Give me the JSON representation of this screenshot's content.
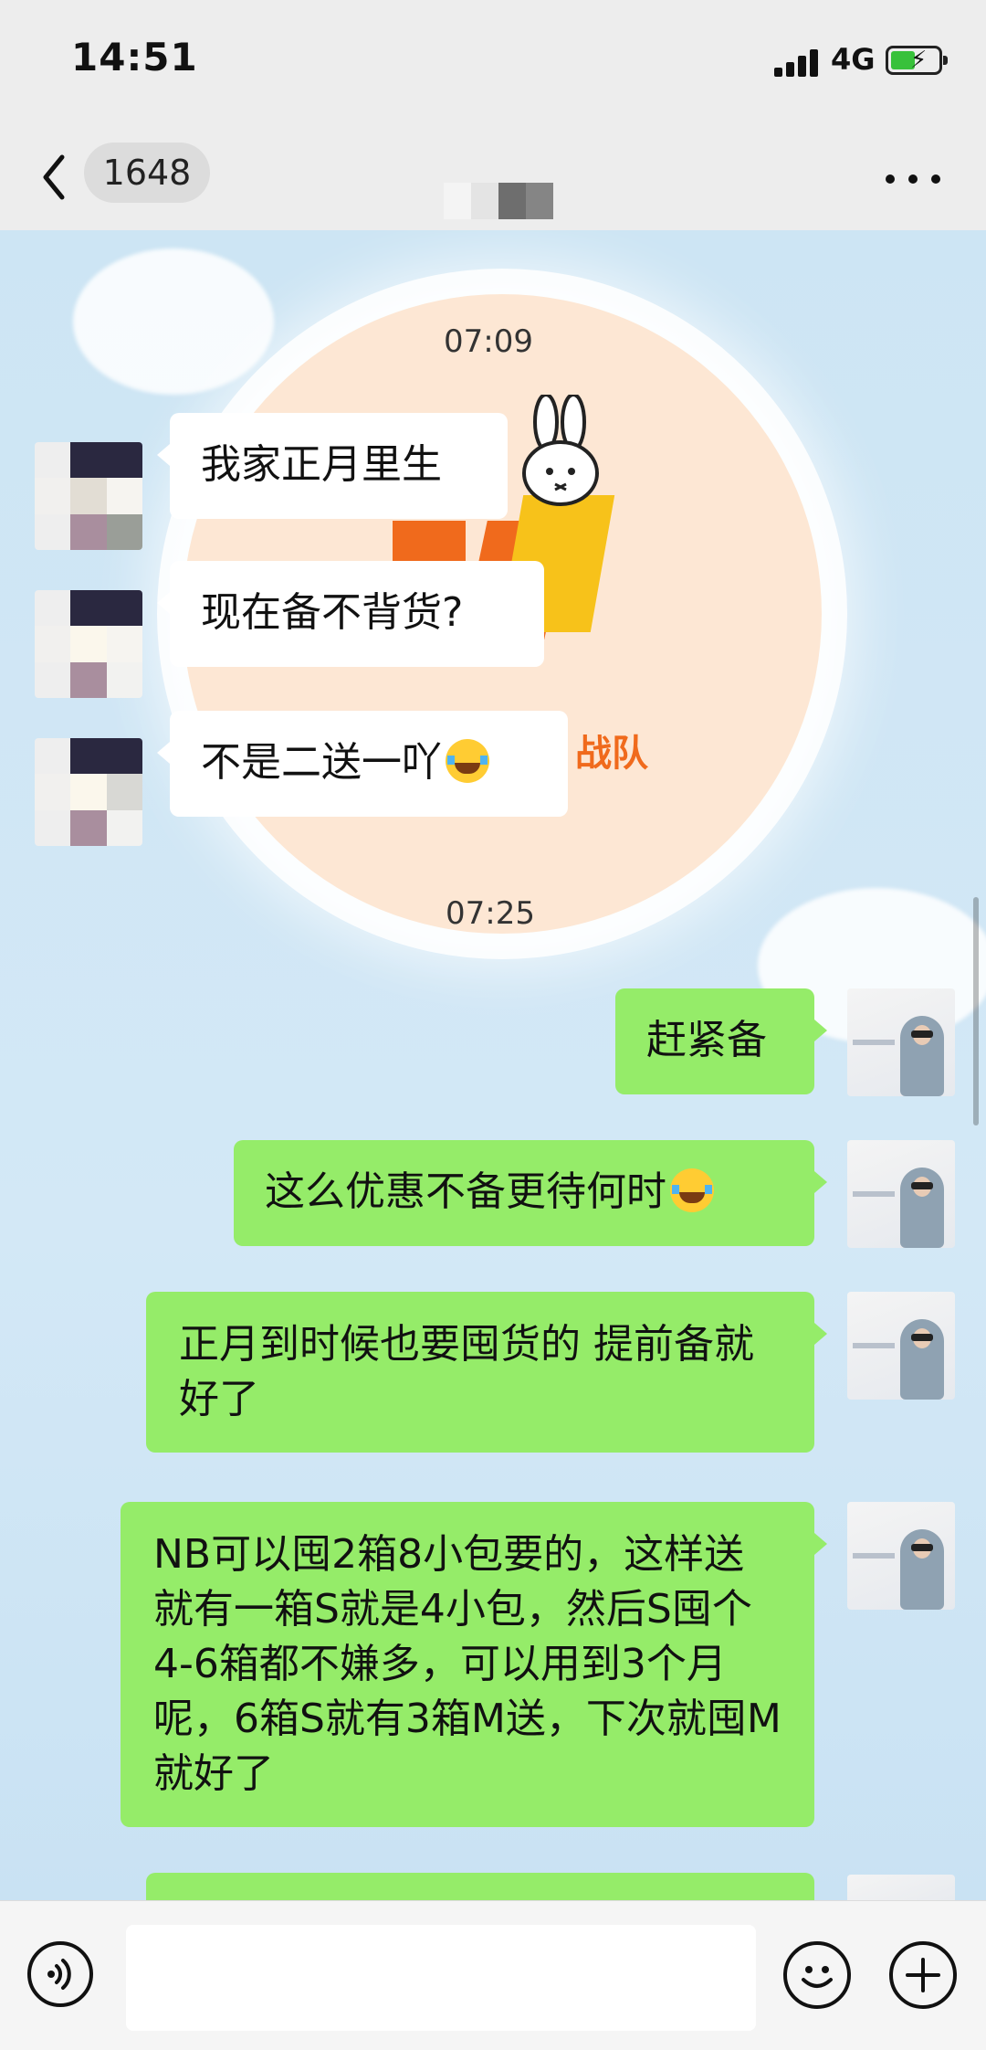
{
  "status_bar": {
    "time": "14:51",
    "network": "4G",
    "battery_charging": true
  },
  "nav": {
    "unread_count": "1648",
    "back_icon": "chevron-left-icon",
    "more_icon": "ellipsis-icon"
  },
  "chat": {
    "background_caption": "战队",
    "timestamps": [
      "07:09",
      "07:25"
    ],
    "messages": [
      {
        "from": "contact",
        "text": "我家正月里生"
      },
      {
        "from": "contact",
        "text": "现在备不背货?"
      },
      {
        "from": "contact",
        "text": "不是二送一吖",
        "emoji": "tears-of-joy-emoji"
      },
      {
        "from": "me",
        "text": "赶紧备"
      },
      {
        "from": "me",
        "text": "这么优惠不备更待何时",
        "emoji": "tears-of-joy-emoji"
      },
      {
        "from": "me",
        "text": "正月到时候也要囤货的 提前备就好了"
      },
      {
        "from": "me",
        "text": "NB可以囤2箱8小包要的，这样送就有一箱S就是4小包，然后S囤个4-6箱都不嫌多，可以用到3个月呢，6箱S就有3箱M送，下次就囤M就好了"
      }
    ]
  },
  "input_bar": {
    "voice_icon": "voice-icon",
    "emoji_icon": "smiley-icon",
    "plus_icon": "plus-icon",
    "input_value": ""
  },
  "colors": {
    "outgoing_bubble": "#95ec69",
    "incoming_bubble": "#ffffff",
    "header_bg": "#ededed"
  }
}
